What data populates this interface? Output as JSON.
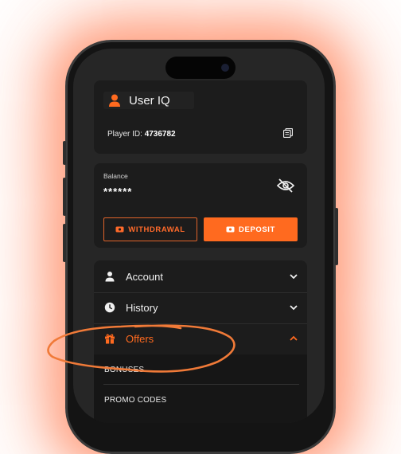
{
  "user": {
    "name": "User IQ",
    "player_id_label": "Player ID:",
    "player_id_value": "4736782"
  },
  "balance": {
    "label": "Balance",
    "value": "******"
  },
  "actions": {
    "withdrawal": "WITHDRAWAL",
    "deposit": "DEPOSIT"
  },
  "menu": {
    "items": [
      {
        "label": "Account",
        "icon": "user-icon",
        "state": "collapsed"
      },
      {
        "label": "History",
        "icon": "clock-icon",
        "state": "collapsed"
      },
      {
        "label": "Offers",
        "icon": "gift-icon",
        "state": "expanded"
      }
    ],
    "offers_sub": [
      {
        "label": "BONUSES"
      },
      {
        "label": "PROMO CODES"
      }
    ]
  },
  "colors": {
    "accent": "#ff6a1f",
    "card_bg": "#1c1c1c",
    "screen_bg": "#262626",
    "glow": "#ff6432"
  }
}
